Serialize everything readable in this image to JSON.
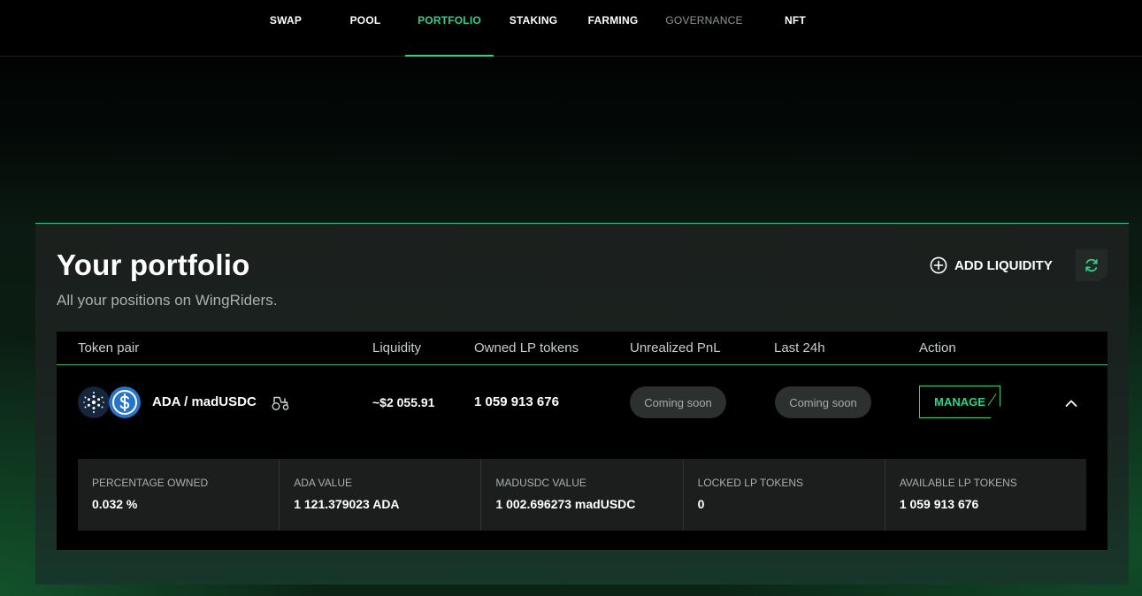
{
  "nav": {
    "items": [
      {
        "label": "SWAP"
      },
      {
        "label": "POOL"
      },
      {
        "label": "PORTFOLIO",
        "active": true
      },
      {
        "label": "STAKING"
      },
      {
        "label": "FARMING"
      },
      {
        "label": "GOVERNANCE",
        "muted": true
      },
      {
        "label": "NFT"
      }
    ]
  },
  "portfolio": {
    "title": "Your portfolio",
    "subtitle": "All your positions on WingRiders.",
    "add_liquidity_label": "ADD LIQUIDITY",
    "table": {
      "headers": [
        "Token pair",
        "Liquidity",
        "Owned LP tokens",
        "Unrealized PnL",
        "Last 24h",
        "Action"
      ],
      "rows": [
        {
          "pair": "ADA / madUSDC",
          "token_icons": [
            "cardano-icon",
            "usdc-icon"
          ],
          "liquidity": "~$2 055.91",
          "owned_lp_tokens": "1 059 913 676",
          "unrealized_pnl": "Coming soon",
          "last_24h": "Coming soon",
          "action": "MANAGE",
          "details": [
            {
              "label": "PERCENTAGE OWNED",
              "value": "0.032 %"
            },
            {
              "label": "ADA VALUE",
              "value": "1 121.379023 ADA"
            },
            {
              "label": "MADUSDC VALUE",
              "value": "1 002.696273 madUSDC"
            },
            {
              "label": "LOCKED LP TOKENS",
              "value": "0"
            },
            {
              "label": "AVAILABLE LP TOKENS",
              "value": "1 059 913 676"
            }
          ]
        }
      ]
    }
  },
  "colors": {
    "accent": "#2fd18a",
    "background": "#000000",
    "panel": "#1b1f1d",
    "pill": "#2c302e"
  }
}
